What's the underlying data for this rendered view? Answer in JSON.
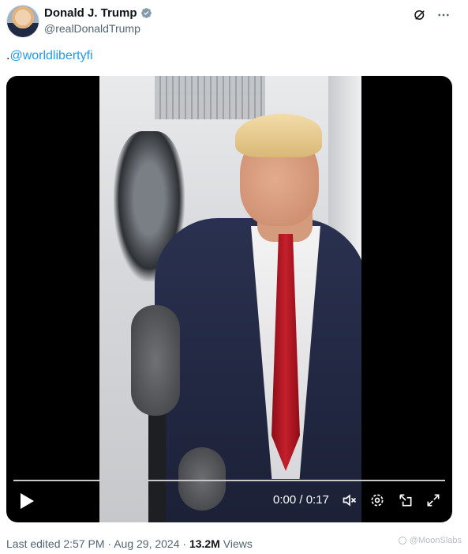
{
  "author": {
    "name": "Donald J. Trump",
    "handle": "@realDonaldTrump",
    "verified_icon": "verified-badge-icon"
  },
  "header_icons": [
    "grok-icon",
    "more-icon"
  ],
  "tweet": {
    "prefix": ".",
    "mention": "@worldlibertyfi"
  },
  "video": {
    "time_display": "0:00 / 0:17",
    "progress": 0,
    "controls": [
      "play-icon",
      "volume-icon",
      "settings-icon",
      "pip-icon",
      "fullscreen-icon"
    ]
  },
  "footer": {
    "edited": "Last edited 2:57 PM · Aug 29, 2024 · ",
    "views_count": "13.2M",
    "views_label": " Views"
  },
  "watermark": "@MoonSlabs",
  "colors": {
    "link": "#1d9bf0",
    "secondary_text": "#536471",
    "verified": "#829aab"
  }
}
